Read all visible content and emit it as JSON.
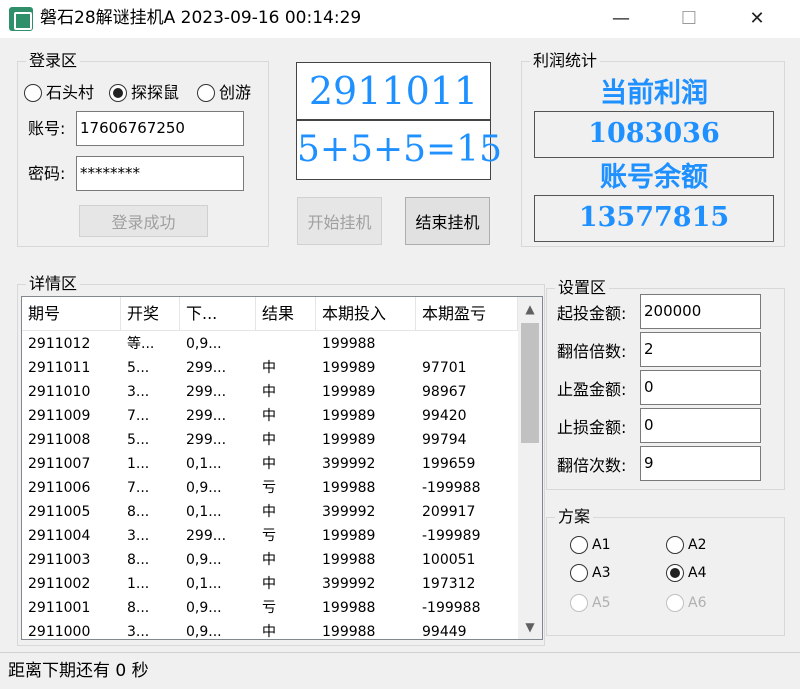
{
  "window": {
    "title": "磐石28解谜挂机A  2023-09-16 00:14:29",
    "min_glyph": "—",
    "max_glyph": "☐",
    "close_glyph": "✕",
    "icon": "app-logo-icon"
  },
  "login": {
    "group_label": "登录区",
    "radios": [
      {
        "label": "石头村",
        "selected": false
      },
      {
        "label": "探探鼠",
        "selected": true
      },
      {
        "label": "创游",
        "selected": false
      }
    ],
    "account_label": "账号:",
    "account_value": "17606767250",
    "password_label": "密码:",
    "password_value": "********",
    "login_button": "登录成功"
  },
  "display": {
    "period": "2911011",
    "formula": "5+5+5=15"
  },
  "actions": {
    "start_button": "开始挂机",
    "stop_button": "结束挂机"
  },
  "profit": {
    "group_label": "利润统计",
    "current_profit_label": "当前利润",
    "current_profit_value": "1083036",
    "balance_label": "账号余额",
    "balance_value": "13577815",
    "accent_color": "#1e90ff"
  },
  "details": {
    "group_label": "详情区",
    "columns": [
      "期号",
      "开奖",
      "下...",
      "结果",
      "本期投入",
      "本期盈亏"
    ],
    "rows": [
      [
        "2911012",
        "等...",
        "0,9...",
        "",
        "199988",
        ""
      ],
      [
        "2911011",
        "5...",
        "299...",
        "中",
        "199989",
        "97701"
      ],
      [
        "2911010",
        "3...",
        "299...",
        "中",
        "199989",
        "98967"
      ],
      [
        "2911009",
        "7...",
        "299...",
        "中",
        "199989",
        "99420"
      ],
      [
        "2911008",
        "5...",
        "299...",
        "中",
        "199989",
        "99794"
      ],
      [
        "2911007",
        "1...",
        "0,1...",
        "中",
        "399992",
        "199659"
      ],
      [
        "2911006",
        "7...",
        "0,9...",
        "亏",
        "199988",
        "-199988"
      ],
      [
        "2911005",
        "8...",
        "0,1...",
        "中",
        "399992",
        "209917"
      ],
      [
        "2911004",
        "3...",
        "299...",
        "亏",
        "199989",
        "-199989"
      ],
      [
        "2911003",
        "8...",
        "0,9...",
        "中",
        "199988",
        "100051"
      ],
      [
        "2911002",
        "1...",
        "0,1...",
        "中",
        "399992",
        "197312"
      ],
      [
        "2911001",
        "8...",
        "0,9...",
        "亏",
        "199988",
        "-199988"
      ],
      [
        "2911000",
        "3...",
        "0,9...",
        "中",
        "199988",
        "99449"
      ]
    ],
    "scroll_up_glyph": "▲",
    "scroll_down_glyph": "▼"
  },
  "settings": {
    "group_label": "设置区",
    "items": [
      {
        "label": "起投金额:",
        "value": "200000"
      },
      {
        "label": "翻倍倍数:",
        "value": "2"
      },
      {
        "label": "止盈金额:",
        "value": "0"
      },
      {
        "label": "止损金额:",
        "value": "0"
      },
      {
        "label": "翻倍次数:",
        "value": "9"
      }
    ]
  },
  "plans": {
    "group_label": "方案",
    "options": [
      {
        "label": "A1",
        "selected": false,
        "enabled": true
      },
      {
        "label": "A2",
        "selected": false,
        "enabled": true
      },
      {
        "label": "A3",
        "selected": false,
        "enabled": true
      },
      {
        "label": "A4",
        "selected": true,
        "enabled": true
      },
      {
        "label": "A5",
        "selected": false,
        "enabled": false
      },
      {
        "label": "A6",
        "selected": false,
        "enabled": false
      }
    ]
  },
  "status": {
    "text": "距离下期还有 0 秒"
  }
}
